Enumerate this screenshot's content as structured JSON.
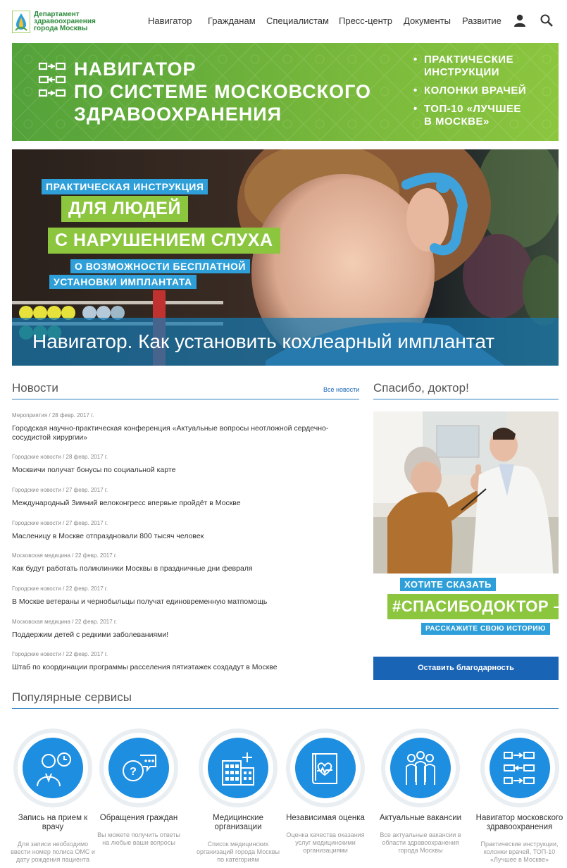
{
  "header": {
    "logo_lines": [
      "Департамент",
      "здравоохранения",
      "города Москвы"
    ],
    "nav": [
      "Навигатор",
      "Гражданам",
      "Специалистам",
      "Пресс-центр",
      "Документы",
      "Развитие"
    ]
  },
  "hero": {
    "title_lines": [
      "НАВИГАТОР",
      "ПО СИСТЕМЕ МОСКОВСКОГО",
      "ЗДРАВООХРАНЕНИЯ"
    ],
    "list": [
      [
        "ПРАКТИЧЕСКИЕ",
        "ИНСТРУКЦИИ"
      ],
      [
        "КОЛОНКИ ВРАЧЕЙ"
      ],
      [
        "ТОП-10 «ЛУЧШЕЕ",
        "В МОСКВЕ»"
      ]
    ],
    "colors": {
      "green_start": "#53a23a",
      "green_end": "#8cc63f"
    }
  },
  "feature": {
    "tag1": "ПРАКТИЧЕСКАЯ ИНСТРУКЦИЯ",
    "tag2": "ДЛЯ ЛЮДЕЙ",
    "tag3": "С НАРУШЕНИЕМ СЛУХА",
    "tag4": "О ВОЗМОЖНОСТИ БЕСПЛАТНОЙ",
    "tag5": "УСТАНОВКИ ИМПЛАНТАТА",
    "caption": "Навигатор. Как установить кохлеарный имплантат"
  },
  "news": {
    "title": "Новости",
    "all_link": "Все новости",
    "items": [
      {
        "meta": "Мероприятия / 28 февр. 2017 г.",
        "title": "Городская научно-практическая конференция «Актуальные вопросы неотложной сердечно-сосудистой хирургии»"
      },
      {
        "meta": "Городские новости / 28 февр. 2017 г.",
        "title": "Москвичи получат бонусы по социальной карте"
      },
      {
        "meta": "Городские новости / 27 февр. 2017 г.",
        "title": "Международный Зимний велоконгресс впервые пройдёт в Москве"
      },
      {
        "meta": "Городские новости / 27 февр. 2017 г.",
        "title": "Масленицу в Москве отпраздновали 800 тысяч человек"
      },
      {
        "meta": "Московская медицина / 22 февр. 2017 г.",
        "title": "Как будут работать поликлиники Москвы в праздничные дни февраля"
      },
      {
        "meta": "Городские новости / 22 февр. 2017 г.",
        "title": "В Москве ветераны и чернобыльцы получат единовременную матпомощь"
      },
      {
        "meta": "Московская медицина / 22 февр. 2017 г.",
        "title": "Поддержим детей с редкими заболеваниями!"
      },
      {
        "meta": "Городские новости / 22 февр. 2017 г.",
        "title": "Штаб по координации программы расселения пятиэтажек создадут в Москве"
      }
    ]
  },
  "thanks": {
    "title": "Спасибо, доктор!",
    "promo1": "ХОТИТЕ СКАЗАТЬ",
    "promo2": "#СПАСИБОДОКТОР –",
    "promo3": "РАССКАЖИТЕ СВОЮ ИСТОРИЮ",
    "button": "Оставить благодарность"
  },
  "services": {
    "title": "Популярные сервисы",
    "items": [
      {
        "icon": "doctor-clock-icon",
        "title": "Запись на прием к врачу",
        "desc": "Для записи необходимо ввести номер полиса ОМС и дату рождения пациента"
      },
      {
        "icon": "question-chat-icon",
        "title": "Обращения граждан",
        "desc": "Вы можете получить ответы на любые ваши вопросы"
      },
      {
        "icon": "hospital-building-icon",
        "title": "Медицинские организации",
        "desc": "Список медицинских организаций города Москвы по категориям"
      },
      {
        "icon": "heart-book-icon",
        "title": "Независимая оценка",
        "desc": "Оценка качества оказания услуг медицинскими организациями"
      },
      {
        "icon": "people-group-icon",
        "title": "Актуальные вакансии",
        "desc": "Все актуальные вакансии в области здравоохранения города Москвы"
      },
      {
        "icon": "navigator-flow-icon",
        "title": "Навигатор московского здравоохранения",
        "desc": "Практические инструкции, колонки врачей, ТОП-10 «Лучшее в Москве»"
      }
    ]
  }
}
